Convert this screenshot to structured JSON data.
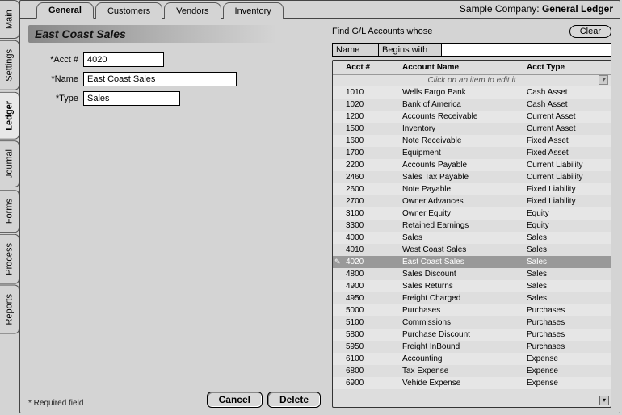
{
  "company_line": {
    "prefix": "Sample Company:",
    "module": "General Ledger"
  },
  "left_tabs": [
    "Main",
    "Settings",
    "Ledger",
    "Journal",
    "Forms",
    "Process",
    "Reports"
  ],
  "left_active": "Ledger",
  "top_tabs": [
    "General",
    "Customers",
    "Vendors",
    "Inventory"
  ],
  "top_active": "General",
  "form": {
    "title": "East Coast Sales",
    "fields": {
      "acct_label": "*Acct #",
      "acct_value": "4020",
      "name_label": "*Name",
      "name_value": "East Coast Sales",
      "type_label": "*Type",
      "type_value": "Sales"
    },
    "footnote": "* Required field",
    "cancel": "Cancel",
    "delete": "Delete"
  },
  "finder": {
    "label": "Find G/L Accounts whose",
    "clear": "Clear",
    "field": "Name",
    "op": "Begins with",
    "value": ""
  },
  "table": {
    "headers": {
      "acct": "Acct #",
      "name": "Account Name",
      "type": "Acct Type"
    },
    "hint": "Click on an item to edit it",
    "selected_acct": "4020",
    "rows": [
      {
        "acct": "1010",
        "name": "Wells Fargo Bank",
        "type": "Cash Asset"
      },
      {
        "acct": "1020",
        "name": "Bank of America",
        "type": "Cash Asset"
      },
      {
        "acct": "1200",
        "name": "Accounts Receivable",
        "type": "Current Asset"
      },
      {
        "acct": "1500",
        "name": "Inventory",
        "type": "Current Asset"
      },
      {
        "acct": "1600",
        "name": "Note Receivable",
        "type": "Fixed Asset"
      },
      {
        "acct": "1700",
        "name": "Equipment",
        "type": "Fixed Asset"
      },
      {
        "acct": "2200",
        "name": "Accounts Payable",
        "type": "Current Liability"
      },
      {
        "acct": "2460",
        "name": "Sales Tax Payable",
        "type": "Current Liability"
      },
      {
        "acct": "2600",
        "name": "Note Payable",
        "type": "Fixed Liability"
      },
      {
        "acct": "2700",
        "name": "Owner Advances",
        "type": "Fixed Liability"
      },
      {
        "acct": "3100",
        "name": "Owner Equity",
        "type": "Equity"
      },
      {
        "acct": "3300",
        "name": "Retained Earnings",
        "type": "Equity"
      },
      {
        "acct": "4000",
        "name": "Sales",
        "type": "Sales"
      },
      {
        "acct": "4010",
        "name": "West Coast Sales",
        "type": "Sales"
      },
      {
        "acct": "4020",
        "name": "East Coast Sales",
        "type": "Sales"
      },
      {
        "acct": "4800",
        "name": "Sales Discount",
        "type": "Sales"
      },
      {
        "acct": "4900",
        "name": "Sales Returns",
        "type": "Sales"
      },
      {
        "acct": "4950",
        "name": "Freight Charged",
        "type": "Sales"
      },
      {
        "acct": "5000",
        "name": "Purchases",
        "type": "Purchases"
      },
      {
        "acct": "5100",
        "name": "Commissions",
        "type": "Purchases"
      },
      {
        "acct": "5800",
        "name": "Purchase Discount",
        "type": "Purchases"
      },
      {
        "acct": "5950",
        "name": "Freight InBound",
        "type": "Purchases"
      },
      {
        "acct": "6100",
        "name": "Accounting",
        "type": "Expense"
      },
      {
        "acct": "6800",
        "name": "Tax Expense",
        "type": "Expense"
      },
      {
        "acct": "6900",
        "name": "Vehide Expense",
        "type": "Expense"
      }
    ]
  }
}
